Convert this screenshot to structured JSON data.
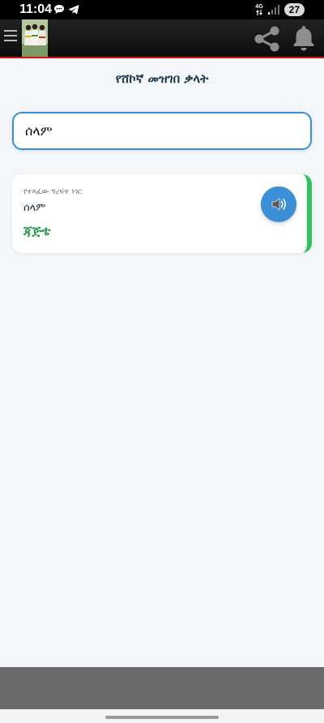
{
  "status_bar": {
    "time": "11:04",
    "network": "4G",
    "battery": "27",
    "notification_icons": [
      "chat-bubble-icon",
      "telegram-icon"
    ]
  },
  "header": {
    "menu_icon": "hamburger-menu-icon",
    "share_icon": "share-icon",
    "bell_icon": "bell-icon"
  },
  "page": {
    "title": "የሸኮኛ መዝገበ ቃላት"
  },
  "search": {
    "value": "ሰላም"
  },
  "result": {
    "label": "የተጻፈው ዓረፍተ ነገር",
    "word": "ሰላም",
    "translation": "ጃጅቴ",
    "speak_icon": "speaker-icon"
  },
  "colors": {
    "accent_blue": "#3a8fd6",
    "accent_green": "#2fc25d",
    "translation_green": "#2c9a4b",
    "header_red_line": "#c81919",
    "title_navy": "#1f3a4d"
  }
}
